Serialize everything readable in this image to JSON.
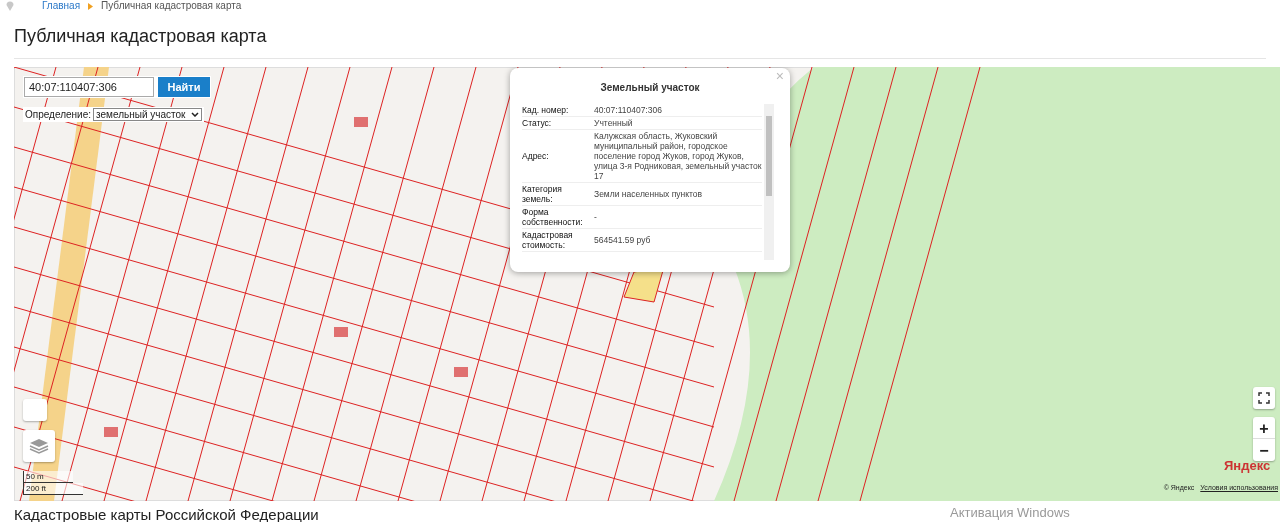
{
  "breadcrumb": [
    {
      "label": "Главная",
      "kind": "link"
    },
    {
      "label": "Публичная кадастровая карта",
      "kind": "current"
    }
  ],
  "title": "Публичная кадастровая карта",
  "map": {
    "search": {
      "value": "40:07:110407:306",
      "button": "Найти"
    },
    "definition": {
      "label": "Определение:",
      "value": "земельный участок"
    },
    "popup": {
      "title": "Земельный участок",
      "close": "×",
      "rows": [
        {
          "label": "Кад. номер:",
          "value": "40:07:110407:306"
        },
        {
          "label": "Статус:",
          "value": "Учтенный"
        },
        {
          "label": "Адрес:",
          "value": "Калужская область, Жуковский муниципальный район, городское поселение город Жуков, город Жуков, улица 3-я Родниковая, земельный участок 17"
        },
        {
          "label": "Категория земель:",
          "value": "Земли населенных пунктов"
        },
        {
          "label": "Форма собственности:",
          "value": "-"
        },
        {
          "label": "Кадастровая стоимость:",
          "value": "564541.59 руб"
        }
      ]
    },
    "scale": [
      "50 m",
      "200 ft"
    ],
    "zoom_in": "+",
    "zoom_out": "−",
    "logo": "Яндекс",
    "attribution": "© Яндекс",
    "terms": "Условия использования"
  },
  "section_heading": "Кадастровые карты Российской Федерации",
  "os_notice": "Активация Windows"
}
